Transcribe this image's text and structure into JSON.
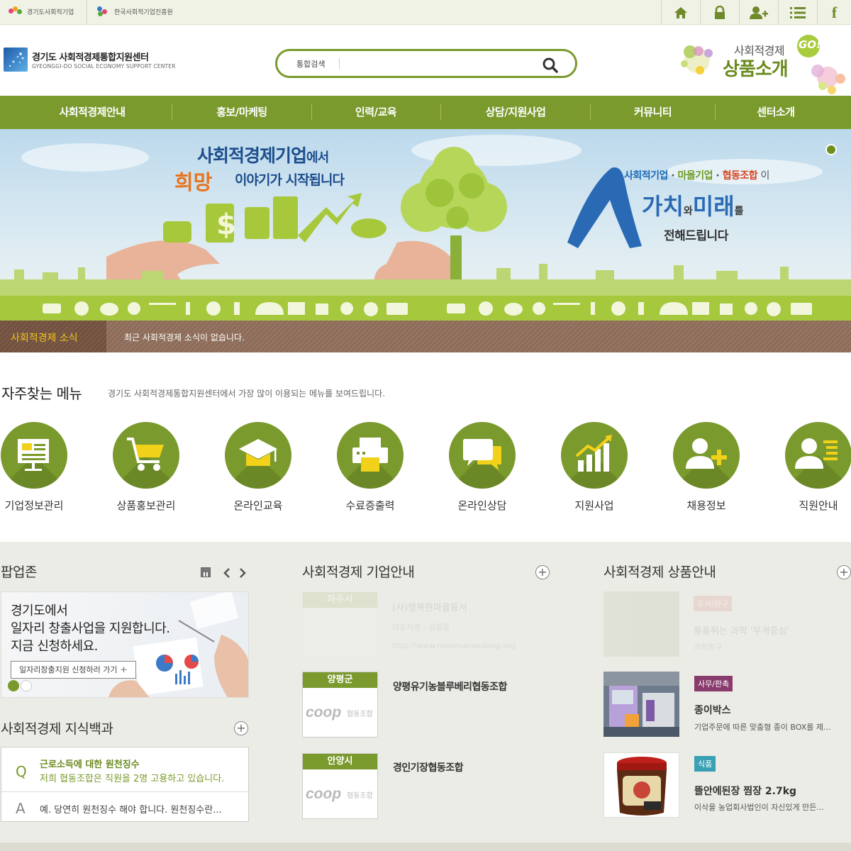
{
  "topbar": {
    "links": [
      "경기도사회적기업",
      "한국사회적기업진흥원"
    ],
    "icons": [
      "home-icon",
      "lock-icon",
      "add-user-icon",
      "sitemap-icon",
      "facebook-icon"
    ]
  },
  "header": {
    "logo_ko": "경기도 사회적경제통합지원센터",
    "logo_en": "GYEONGGI-DO SOCIAL ECONOMY SUPPORT CENTER",
    "search_label": "통합검색",
    "search_placeholder": "",
    "go_banner": {
      "line1": "사회적경제",
      "line2": "상품소개",
      "badge": "GO!"
    }
  },
  "nav": [
    "사회적경제안내",
    "홍보/마케팅",
    "인력/교육",
    "상담/지원사업",
    "커뮤니티",
    "센터소개"
  ],
  "hero": {
    "left_line1": "사회적경제기업",
    "left_line1_suffix": "에서",
    "left_hope": "희망",
    "left_line2": "이야기가 시작됩니다",
    "right_orgs": [
      "사회적기업",
      "마을기업",
      "협동조합"
    ],
    "right_org_suffix": "이",
    "right_value": "가치",
    "right_and": "와",
    "right_future": "미래",
    "right_obj": "를",
    "right_line3": "전해드립니다",
    "colors": {
      "org1": "#1a6bb5",
      "org2": "#6b9a1f",
      "org3": "#d9451f"
    }
  },
  "news": {
    "label": "사회적경제 소식",
    "text": "최근 사회적경제 소식이 없습니다."
  },
  "quick": {
    "title": "자주찾는 메뉴",
    "desc": "경기도 사회적경제통합지원센터에서 가장 많이 이용되는 메뉴를 보여드립니다.",
    "items": [
      {
        "label": "기업정보관리",
        "icon": "board-icon"
      },
      {
        "label": "상품홍보관리",
        "icon": "cart-icon"
      },
      {
        "label": "온라인교육",
        "icon": "graduation-cap-icon"
      },
      {
        "label": "수료증출력",
        "icon": "printer-icon"
      },
      {
        "label": "온라인상담",
        "icon": "chat-icon"
      },
      {
        "label": "지원사업",
        "icon": "growth-chart-icon"
      },
      {
        "label": "채용정보",
        "icon": "add-person-icon"
      },
      {
        "label": "직원안내",
        "icon": "staff-list-icon"
      }
    ]
  },
  "popup": {
    "title": "팝업존",
    "line1": "경기도에서",
    "line2": "일자리 창출사업을 지원합니다.",
    "line3": "지금 신청하세요.",
    "button": "일자리창출지원 신청하러 가기 ＋"
  },
  "knowledge": {
    "title": "사회적경제 지식백과",
    "q_mark": "Q",
    "a_mark": "A",
    "q_title": "근로소득에 대한 원천징수",
    "q_text": "저희 협동조합은 직원을 2명 고용하고 있습니다.",
    "a_text": "예. 당연히 원천징수 해야 합니다. 원천징수란..."
  },
  "companies": {
    "title": "사회적경제 기업안내",
    "faded": {
      "region": "파주시",
      "name": "(사)행복한마을동서",
      "rep": "대표자명 : 김양중",
      "url": "http://www.moonsaraedong.org"
    },
    "items": [
      {
        "region": "양평군",
        "name": "양평유기농블루베리협동조합",
        "logo": "coop",
        "logo_sub": "협동조합"
      },
      {
        "region": "안양시",
        "name": "경인기장협동조합",
        "logo": "coop",
        "logo_sub": "협동조합"
      }
    ]
  },
  "products": {
    "title": "사회적경제 상품안내",
    "faded": {
      "badge": "도서/완구",
      "name": "통통튀는 과학 '무게중심'",
      "desc": "과학완구"
    },
    "items": [
      {
        "badge": "사무/판촉",
        "badge_color": "#8a3b6e",
        "name": "종이박스",
        "desc": "기업주문에 따른 맞춤형 종이 BOX를 제..."
      },
      {
        "badge": "식품",
        "badge_color": "#3aa0b4",
        "name": "뜰안에된장 찜장 2.7kg",
        "desc": "이삭을 농업회사법인이 자신있게 만든..."
      }
    ]
  }
}
